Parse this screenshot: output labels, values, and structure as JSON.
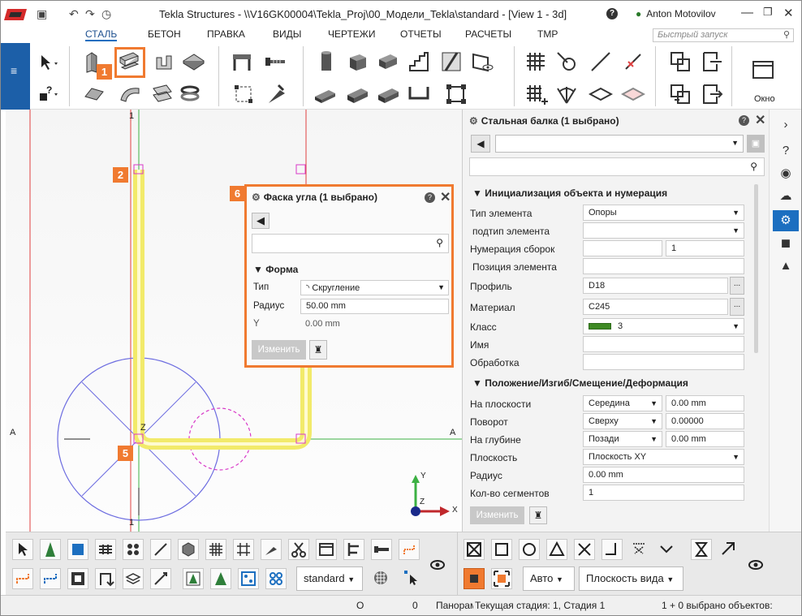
{
  "titlebar": {
    "title": "Tekla Structures - \\\\V16GK00004\\Tekla_Proj\\00_Модели_Tekla\\standard  - [View 1 - 3d]",
    "user": "Anton Motovilov",
    "help_label": "?"
  },
  "tabs": [
    "СТАЛЬ",
    "БЕТОН",
    "ПРАВКА",
    "ВИДЫ",
    "ЧЕРТЕЖИ",
    "ОТЧЕТЫ",
    "РАСЧЕТЫ",
    "TMP"
  ],
  "active_tab": "СТАЛЬ",
  "quick_launch": {
    "placeholder": "Быстрый запуск"
  },
  "ribbon": {
    "window_label": "Окно"
  },
  "viewport": {
    "grid_labels": {
      "top1": "1",
      "bottom1": "1",
      "left_a": "A",
      "right_a": "A"
    },
    "axis_labels": {
      "y": "Y",
      "x": "X",
      "z": "Z"
    },
    "vertex_label": "Z"
  },
  "badges": [
    "1",
    "2",
    "3",
    "4",
    "5",
    "6"
  ],
  "fillet_dialog": {
    "title": "Фаска угла (1 выбрано)",
    "section": "Форма",
    "type_label": "Тип",
    "type_value": "Скругление",
    "radius_label": "Радиус",
    "radius_value": "50.00 mm",
    "y_label": "Y",
    "y_value": "0.00 mm",
    "modify_button": "Изменить"
  },
  "properties": {
    "title": "Стальная балка (1 выбрано)",
    "section1": "Инициализация объекта и нумерация",
    "section2": "Положение/Изгиб/Смещение/Деформация",
    "rows1": [
      {
        "label": "Тип элемента",
        "value": "Опоры"
      },
      {
        "label": "подтип элемента",
        "value": ""
      },
      {
        "label": "Нумерация сборок",
        "value": "",
        "value2": "1"
      },
      {
        "label": "Позиция элемента",
        "value": ""
      },
      {
        "label": "Профиль",
        "value": "D18"
      },
      {
        "label": "Материал",
        "value": "C245"
      },
      {
        "label": "Класс",
        "value": "3"
      },
      {
        "label": "Имя",
        "value": ""
      },
      {
        "label": "Обработка",
        "value": ""
      }
    ],
    "rows2": [
      {
        "label": "На плоскости",
        "value": "Середина",
        "value2": "0.00 mm"
      },
      {
        "label": "Поворот",
        "value": "Сверху",
        "value2": "0.00000"
      },
      {
        "label": "На глубине",
        "value": "Позади",
        "value2": "0.00 mm"
      },
      {
        "label": "Плоскость",
        "value": "Плоскость XY"
      },
      {
        "label": "Радиус",
        "value": "0.00 mm"
      },
      {
        "label": "Кол-во сегментов",
        "value": "1"
      }
    ],
    "modify_button": "Изменить",
    "class_color": "#3f8a25"
  },
  "bottom": {
    "filter_select": "standard",
    "snap_select": "Авто",
    "plane_select": "Плоскость вида"
  },
  "status": {
    "o_label": "O",
    "zero": "0",
    "panorama": "Панорам",
    "stage": "Текущая стадия: 1, Стадия 1",
    "selected": "1 + 0 выбрано объектов:"
  },
  "colors": {
    "accent": "#f07a30",
    "brand": "#1c5fa8",
    "highlight": "#f7ef5a"
  }
}
